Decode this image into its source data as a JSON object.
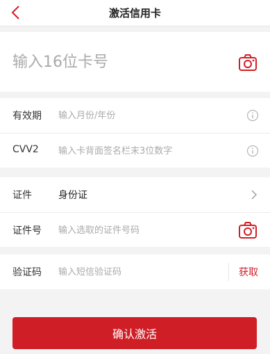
{
  "header": {
    "title": "激活信用卡",
    "back_icon": "chevron-left-icon"
  },
  "card_number": {
    "placeholder": "输入16位卡号",
    "scan_icon": "camera-icon"
  },
  "card_info": {
    "expiry_label": "有效期",
    "expiry_placeholder": "输入月份/年份",
    "cvv_label": "CVV2",
    "cvv_placeholder": "输入卡背面签名栏末3位数字",
    "info_icon": "info-icon"
  },
  "id_info": {
    "id_type_label": "证件",
    "id_type_value": "身份证",
    "id_number_label": "证件号",
    "id_number_placeholder": "输入选取的证件号码",
    "scan_icon": "camera-icon"
  },
  "verification": {
    "label": "验证码",
    "placeholder": "输入短信验证码",
    "get_code_label": "获取"
  },
  "confirm_label": "确认激活",
  "colors": {
    "accent": "#d01e26",
    "background": "#f3f3f3",
    "placeholder": "#aaaaaa"
  }
}
